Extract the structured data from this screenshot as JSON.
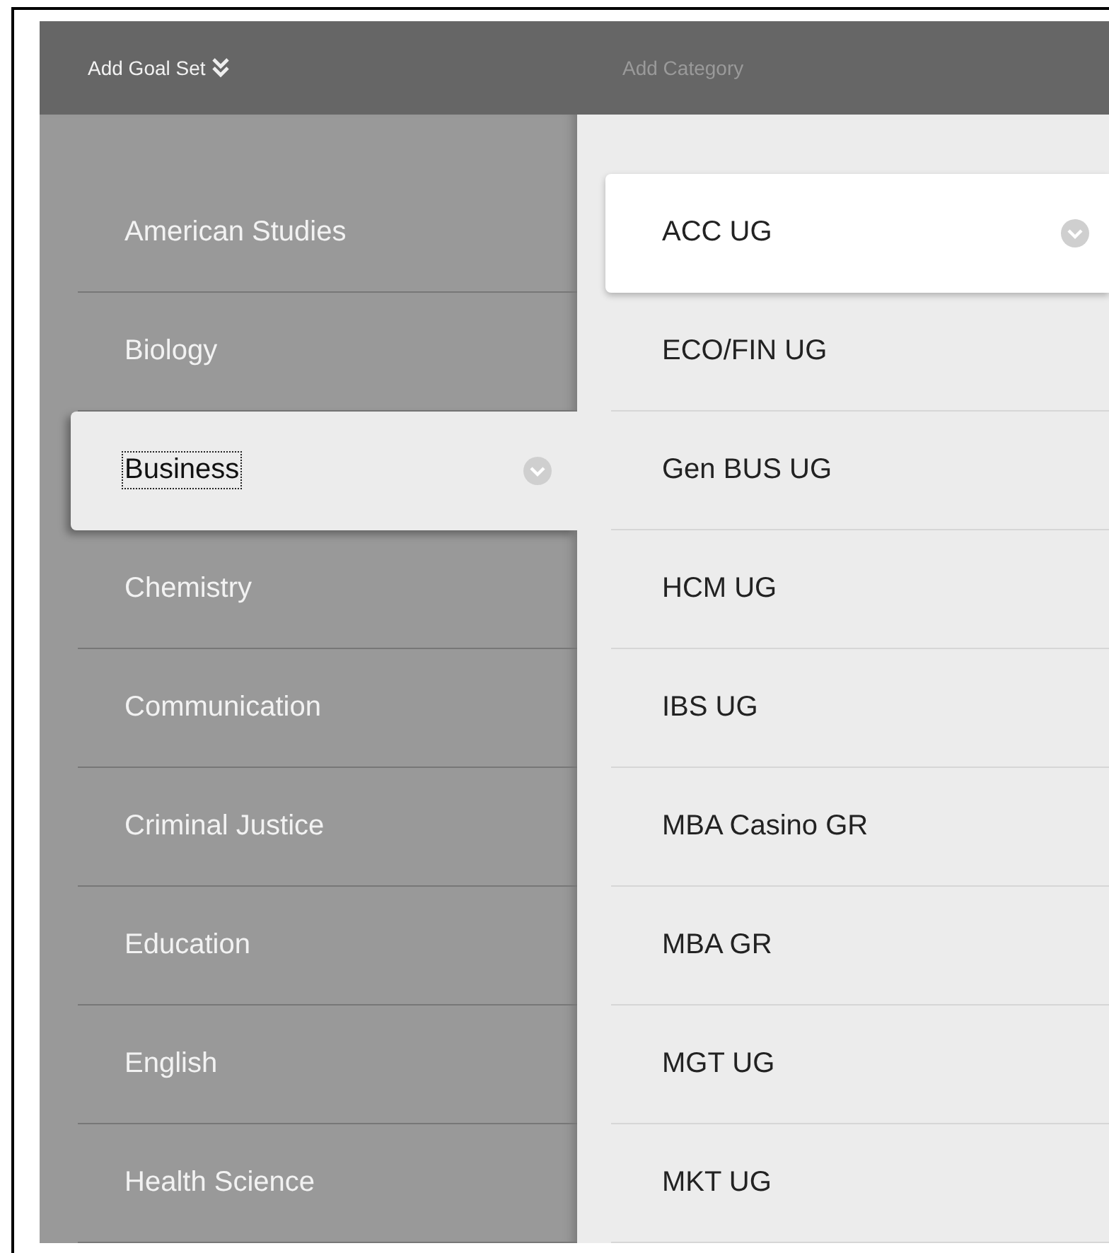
{
  "header": {
    "add_goal_set": "Add Goal Set",
    "add_category": {
      "label": "Add Category",
      "disabled": true
    }
  },
  "goal_sets": [
    {
      "label": "American Studies",
      "selected": false
    },
    {
      "label": "Biology",
      "selected": false
    },
    {
      "label": "Business",
      "selected": true
    },
    {
      "label": "Chemistry",
      "selected": false
    },
    {
      "label": "Communication",
      "selected": false
    },
    {
      "label": "Criminal Justice",
      "selected": false
    },
    {
      "label": "Education",
      "selected": false
    },
    {
      "label": "English",
      "selected": false
    },
    {
      "label": "Health Science",
      "selected": false
    }
  ],
  "categories": [
    {
      "label": "ACC UG",
      "selected": true
    },
    {
      "label": "ECO/FIN UG",
      "selected": false
    },
    {
      "label": "Gen BUS UG",
      "selected": false
    },
    {
      "label": "HCM UG",
      "selected": false
    },
    {
      "label": "IBS UG",
      "selected": false
    },
    {
      "label": "MBA Casino GR",
      "selected": false
    },
    {
      "label": "MBA GR",
      "selected": false
    },
    {
      "label": "MGT UG",
      "selected": false
    },
    {
      "label": "MKT UG",
      "selected": false
    }
  ]
}
